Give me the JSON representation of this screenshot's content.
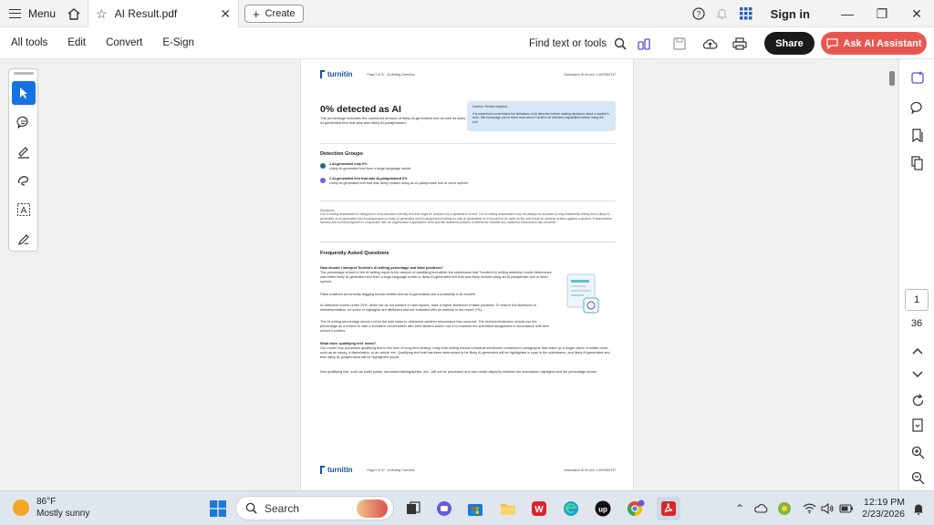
{
  "titlebar": {
    "menu_label": "Menu",
    "tab_title": "AI Result.pdf",
    "create_label": "Create",
    "signin_label": "Sign in"
  },
  "toolbar": {
    "all_tools": "All tools",
    "edit": "Edit",
    "convert": "Convert",
    "esign": "E-Sign",
    "find_label": "Find text or tools",
    "share_label": "Share",
    "ai_label": "Ask AI Assistant"
  },
  "document": {
    "logo_text": "turnitin",
    "header_mid": "Page 2 of 37 - AI Writing Overview",
    "header_right": "Submission ID trn:oid:::1:3037804737",
    "pct_heading": "0% detected as AI",
    "pct_desc": "The percentage indicates the combined amount of likely AI-generated text as well as likely AI-generated text that was also likely AI-paraphrased.",
    "caution_title": "Caution: Review required.",
    "caution_text": "It is essential to understand the limitations of AI detection before making decisions about a student's work. We encourage you to learn more about Turnitin's AI detection capabilities before using the tool.",
    "detection_heading": "Detection Groups",
    "group1_title": "1  AI-generated only  0%",
    "group1_desc": "Likely AI-generated text from a large-language model.",
    "group2_title": "2  AI-generated text that was AI-paraphrased  0%",
    "group2_desc": "Likely AI-generated text that was likely revised using an AI-paraphrase tool or word spinner.",
    "disclaimer_title": "Disclaimer",
    "disclaimer_text": "Our AI writing assessment is designed to help educators identify text that might be prepared by a generative AI tool. Our AI writing assessment may not always be accurate (it may misidentify writing that is likely AI generated as AI generated and AI paraphrased or likely AI generated and AI paraphrased writing as only AI generated) so it should not be used as the sole basis for adverse actions against a student. It takes further scrutiny and human judgment in conjunction with an organization's application of its specific academic policies to determine whether any academic misconduct has occurred.",
    "faq_heading": "Frequently Asked Questions",
    "faq1_q": "How should I interpret Turnitin's AI writing percentage and false positives?",
    "faq1_a": "The percentage shown in the AI writing report is the amount of qualifying text within the submission that Turnitin's AI writing detection model determines was either likely AI-generated text from a large-language model or likely AI-generated text that was likely revised using an AI-paraphrase tool or word spinner.",
    "faq1_b": "False positives (incorrectly flagging human-written text as AI-generated) are a possibility in AI models.",
    "faq1_c": "AI detection scores under 20%, which we do not surface in new reports, have a higher likelihood of false positives. To reduce the likelihood of misinterpretation, no score or highlights are attributed and are indicated with an asterisk in the report (*%).",
    "faq1_d": "The AI writing percentage should not be the sole basis to determine whether misconduct has occurred. The reviewer/instructor should use the percentage as a means to start a formative conversation with their student and/or use it to examine the submitted assignment in accordance with their school's policies.",
    "faq2_q": "What does 'qualifying text' mean?",
    "faq2_a": "Our model only processes qualifying text in the form of long-form writing. Long-form writing means individual sentences contained in paragraphs that make up a longer piece of written work, such as an essay, a dissertation, or an article, etc. Qualifying text that has been determined to be likely AI-generated will be highlighted in cyan in the submission, and likely AI-generated and then likely AI-paraphrased will be highlighted purple.",
    "faq2_b": "Non-qualifying text, such as bullet points, annotated bibliographies, etc., will not be processed and can create disparity between the submission highlights and the percentage shown.",
    "footer_mid": "Page 2 of 37 - AI Writing Overview",
    "footer_right": "Submission ID trn:oid:::1:3037804737"
  },
  "pager": {
    "current": "1",
    "total": "36"
  },
  "taskbar": {
    "temp": "86°F",
    "condition": "Mostly sunny",
    "search_label": "Search",
    "time": "12:19 PM",
    "date": "2/23/2026"
  },
  "colors": {
    "accent_blue": "#1473e6",
    "ai_button": "#e8574f",
    "caution_bg": "#d6e8f7",
    "group1": "#1f6e7a",
    "group2": "#7b5ad6"
  }
}
